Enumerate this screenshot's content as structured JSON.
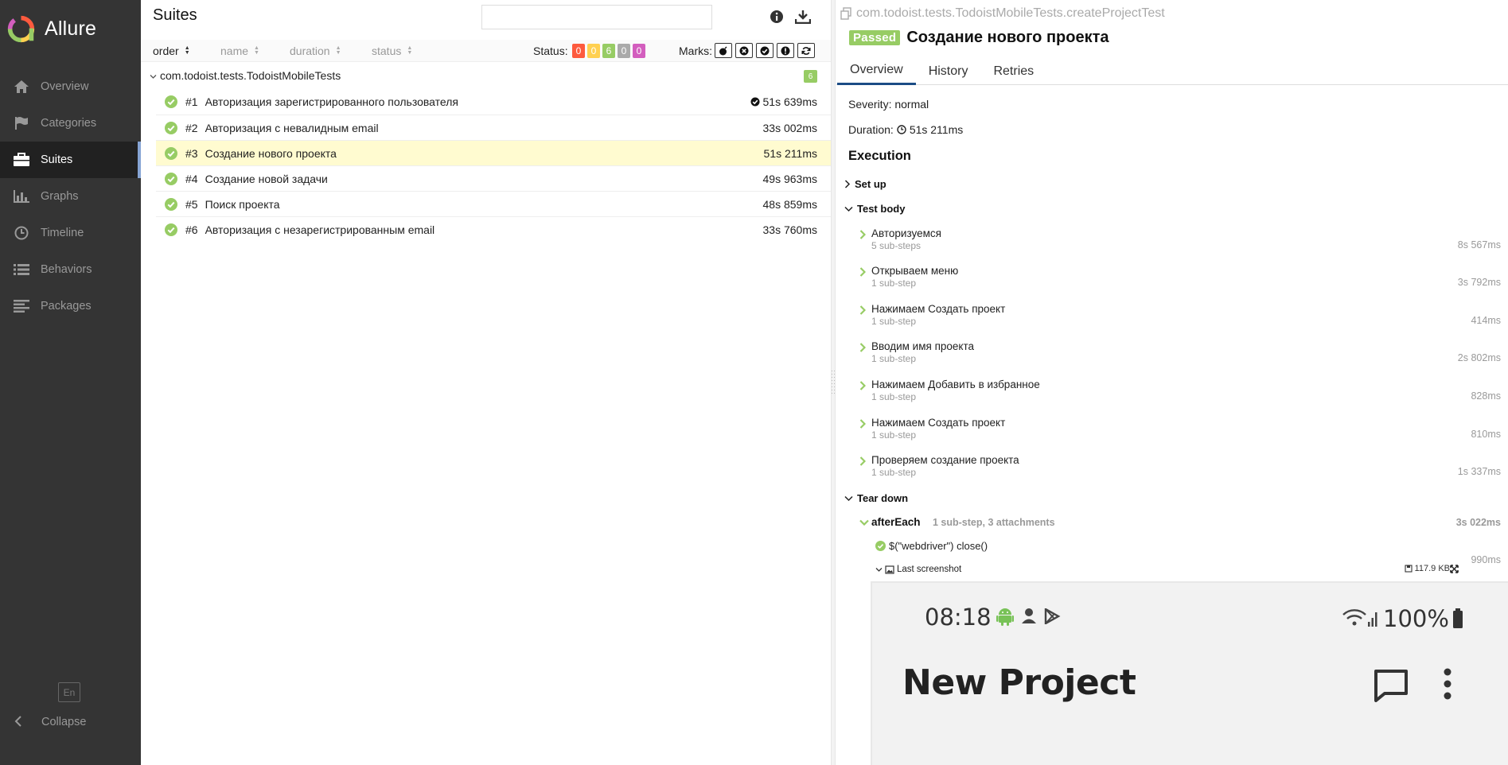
{
  "app": {
    "name": "Allure"
  },
  "sidebar": {
    "items": [
      {
        "label": "Overview",
        "icon": "home-icon"
      },
      {
        "label": "Categories",
        "icon": "flag-icon"
      },
      {
        "label": "Suites",
        "icon": "briefcase-icon",
        "active": true
      },
      {
        "label": "Graphs",
        "icon": "bar-chart-icon"
      },
      {
        "label": "Timeline",
        "icon": "clock-icon"
      },
      {
        "label": "Behaviors",
        "icon": "list-icon"
      },
      {
        "label": "Packages",
        "icon": "align-left-icon"
      }
    ],
    "language": "En",
    "collapse_label": "Collapse"
  },
  "suites": {
    "title": "Suites",
    "search_value": "",
    "sort": {
      "order": "order",
      "name": "name",
      "duration": "duration",
      "status": "status"
    },
    "status_label": "Status:",
    "counters": [
      {
        "value": "0",
        "color": "#fd5a3e"
      },
      {
        "value": "0",
        "color": "#ffd050"
      },
      {
        "value": "6",
        "color": "#97cc64"
      },
      {
        "value": "0",
        "color": "#aaaaaa"
      },
      {
        "value": "0",
        "color": "#d35ebe"
      }
    ],
    "marks_label": "Marks:",
    "marks": [
      "flaky-icon",
      "new-failed-icon",
      "new-passed-icon",
      "new-broken-icon",
      "retries-icon"
    ],
    "group": {
      "name": "com.todoist.tests.TodoistMobileTests",
      "count": "6"
    },
    "tests": [
      {
        "num": "#1",
        "name": "Авторизация зарегистрированного пользователя",
        "duration": "51s 639ms",
        "mark": true
      },
      {
        "num": "#2",
        "name": "Авторизация с невалидным email",
        "duration": "33s 002ms"
      },
      {
        "num": "#3",
        "name": "Создание нового проекта",
        "duration": "51s 211ms",
        "selected": true
      },
      {
        "num": "#4",
        "name": "Создание новой задачи",
        "duration": "49s 963ms"
      },
      {
        "num": "#5",
        "name": "Поиск проекта",
        "duration": "48s 859ms"
      },
      {
        "num": "#6",
        "name": "Авторизация с незарегистрированным email",
        "duration": "33s 760ms"
      }
    ]
  },
  "detail": {
    "full_name": "com.todoist.tests.TodoistMobileTests.createProjectTest",
    "status": "Passed",
    "title": "Создание нового проекта",
    "tabs": [
      "Overview",
      "History",
      "Retries"
    ],
    "severity": "Severity: normal",
    "duration_label": "Duration:",
    "duration": "51s 211ms",
    "execution_title": "Execution",
    "setup_label": "Set up",
    "testbody_label": "Test body",
    "teardown_label": "Tear down",
    "steps": [
      {
        "name": "Авторизуемся",
        "sub": "5 sub-steps",
        "duration": "8s 567ms"
      },
      {
        "name": "Открываем меню",
        "sub": "1 sub-step",
        "duration": "3s 792ms"
      },
      {
        "name": "Нажимаем Создать проект",
        "sub": "1 sub-step",
        "duration": "414ms"
      },
      {
        "name": "Вводим имя проекта",
        "sub": "1 sub-step",
        "duration": "2s 802ms"
      },
      {
        "name": "Нажимаем Добавить в избранное",
        "sub": "1 sub-step",
        "duration": "828ms"
      },
      {
        "name": "Нажимаем Создать проект",
        "sub": "1 sub-step",
        "duration": "810ms"
      },
      {
        "name": "Проверяем создание проекта",
        "sub": "1 sub-step",
        "duration": "1s 337ms"
      }
    ],
    "after_each": {
      "name": "afterEach",
      "info": "1 sub-step, 3 attachments",
      "duration": "3s 022ms"
    },
    "webdriver_step": {
      "name": "$(\"webdriver\") close()",
      "duration": "990ms"
    },
    "attachment": {
      "name": "Last screenshot",
      "size": "117.9 KB"
    },
    "phone": {
      "time": "08:18",
      "battery": "100%",
      "title": "New Project"
    }
  }
}
